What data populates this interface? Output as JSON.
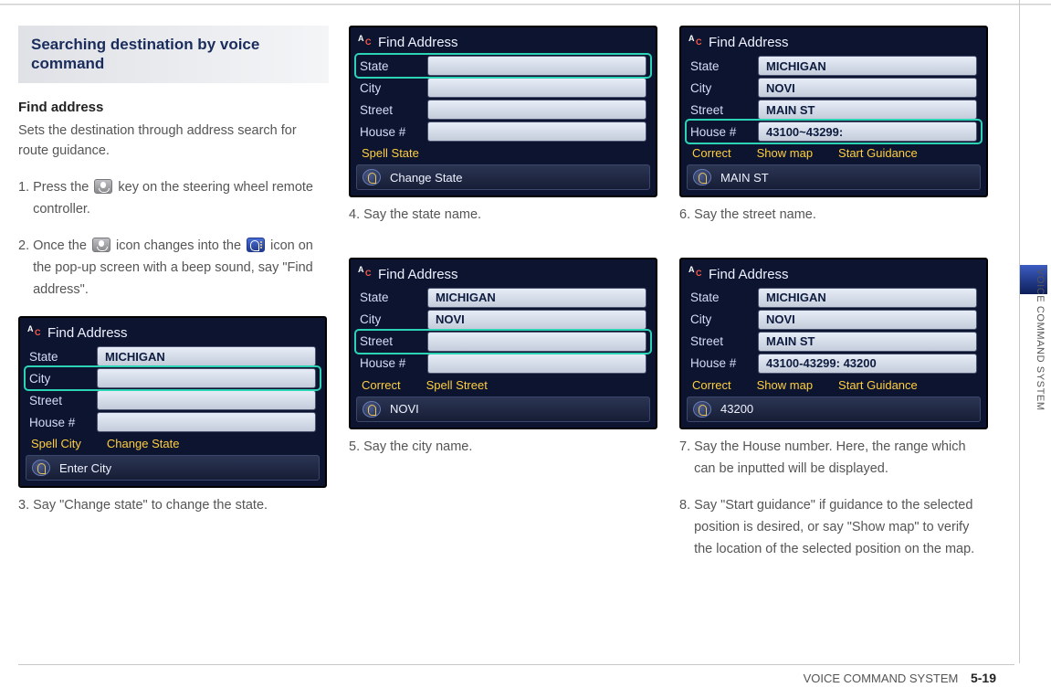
{
  "page": {
    "section_heading": "Searching destination by voice command",
    "sub_heading": "Find address",
    "intro": "Sets the destination through address search for route guidance.",
    "side_tab": "VOICE COMMAND SYSTEM",
    "footer_label": "VOICE COMMAND SYSTEM",
    "footer_page": "5-19"
  },
  "steps": {
    "s1_num": "1.",
    "s1a": "Press the",
    "s1b": "key on the steering wheel remote controller.",
    "s2_num": "2.",
    "s2a": "Once the",
    "s2b": "icon changes into the",
    "s2c": "icon on the pop-up screen with a beep sound, say \"Find address\".",
    "s3_num": "3.",
    "s3": "Say \"Change state\" to change the state.",
    "s4_num": "4.",
    "s4": "Say the state name.",
    "s5_num": "5.",
    "s5": "Say the city name.",
    "s6_num": "6.",
    "s6": "Say the street name.",
    "s7_num": "7.",
    "s7": "Say the House number. Here, the range which can be inputted will be displayed.",
    "s8_num": "8.",
    "s8": "Say \"Start guidance\" if guidance to the selected position is desired, or say \"Show map\" to verify the location of the selected position on the map."
  },
  "screens": {
    "title": "Find Address",
    "labels": {
      "state": "State",
      "city": "City",
      "street": "Street",
      "house": "House #"
    },
    "cmds": {
      "spell_city": "Spell City",
      "change_state": "Change State",
      "spell_state": "Spell State",
      "spell_street": "Spell Street",
      "correct": "Correct",
      "show_map": "Show map",
      "start_guidance": "Start Guidance"
    },
    "status": {
      "enter_city": "Enter City",
      "change_state": "Change State",
      "novi": "NOVI",
      "main_st": "MAIN ST",
      "n43200": "43200"
    },
    "values": {
      "michigan": "MICHIGAN",
      "novi": "NOVI",
      "main_st": "MAIN ST",
      "range1": "43100~43299:",
      "range2": "43100-43299: 43200"
    }
  }
}
